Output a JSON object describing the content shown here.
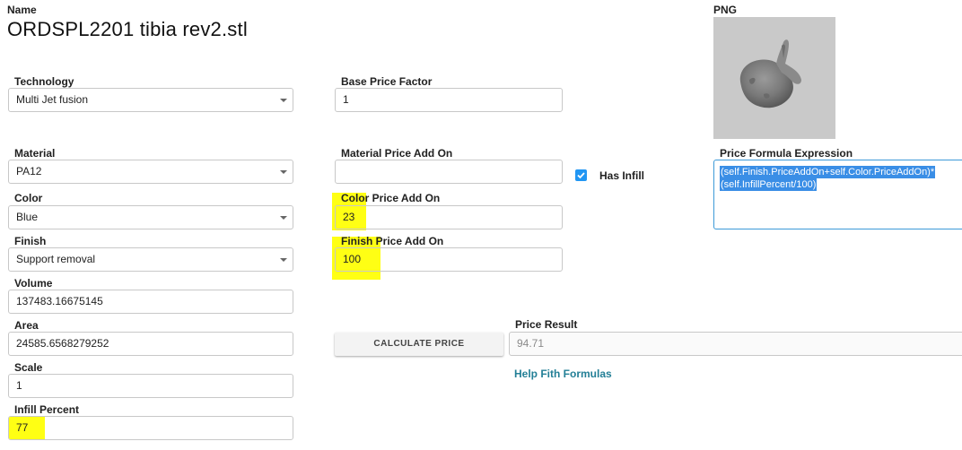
{
  "header": {
    "name_label": "Name",
    "title": "ORDSPL2201 tibia rev2.stl"
  },
  "png": {
    "label": "PNG"
  },
  "left": {
    "technology": {
      "label": "Technology",
      "value": "Multi Jet fusion"
    },
    "material": {
      "label": "Material",
      "value": "PA12"
    },
    "color": {
      "label": "Color",
      "value": "Blue"
    },
    "finish": {
      "label": "Finish",
      "value": "Support removal"
    },
    "volume": {
      "label": "Volume",
      "value": "137483.16675145"
    },
    "area": {
      "label": "Area",
      "value": "24585.6568279252"
    },
    "scale": {
      "label": "Scale",
      "value": "1"
    },
    "infill": {
      "label": "Infill Percent",
      "value": "77"
    }
  },
  "middle": {
    "base_price": {
      "label": "Base Price Factor",
      "value": "1"
    },
    "material_addon": {
      "label": "Material Price Add On",
      "value": ""
    },
    "color_addon": {
      "label": "Color Price Add On",
      "value": "23"
    },
    "finish_addon": {
      "label": "Finish Price Add On",
      "value": "100"
    },
    "calculate_label": "CALCULATE PRICE"
  },
  "infill_toggle": {
    "label": "Has Infill",
    "checked": true
  },
  "result": {
    "label": "Price Result",
    "value": "94.71",
    "help_link": "Help Fith Formulas"
  },
  "formula": {
    "label": "Price Formula Expression",
    "line1": "(self.Finish.PriceAddOn+self.Color.PriceAddOn)*",
    "line2": "(self.InfillPercent/100)"
  },
  "colors": {
    "highlight": "#ffff14",
    "accent": "#2196f3",
    "link": "#237f96",
    "selection": "#3a8ee6"
  },
  "icons": {
    "dropdown": "chevron-down-icon",
    "checkbox": "check-icon"
  }
}
